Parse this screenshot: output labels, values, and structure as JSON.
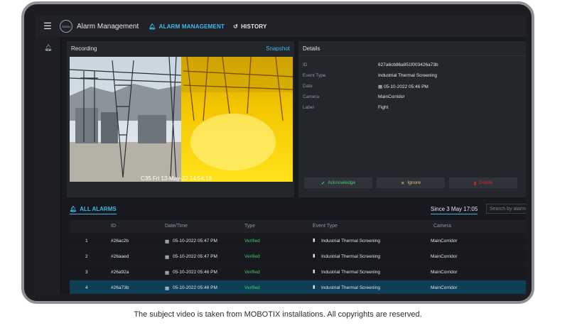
{
  "header": {
    "logo_text": "SOGU",
    "app_title": "Alarm Management",
    "nav_alarm": "ALARM MANAGEMENT",
    "nav_history": "HISTORY"
  },
  "recording": {
    "title": "Recording",
    "snapshot_label": "Snapshot",
    "timestamp": "C35 Fri 13-May-22 14:54:18"
  },
  "details": {
    "title": "Details",
    "rows": [
      {
        "label": "ID",
        "value": "627a6cb86a951f003426a73b"
      },
      {
        "label": "Event Type",
        "value": "Industrial Thermal Screening"
      },
      {
        "label": "Date",
        "value": "05-10-2022 05:46 PM"
      },
      {
        "label": "Camera",
        "value": "MainCorridor"
      },
      {
        "label": "Label",
        "value": "Fight"
      }
    ],
    "buttons": {
      "acknowledge": "Acknowledge",
      "ignore": "Ignore",
      "delete": "Delete"
    }
  },
  "alarms": {
    "title": "ALL ALARMS",
    "since": "Since 3 May 17:05",
    "search_placeholder": "Search by alarm",
    "columns": [
      "ID",
      "Date/Time",
      "Type",
      "Event Type",
      "Camera"
    ],
    "rows": [
      {
        "n": "1",
        "id": "#26ac2b",
        "date": "05-10-2022 05:47 PM",
        "type": "Verified",
        "event": "Industrial Thermal Screening",
        "camera": "MainCorridor"
      },
      {
        "n": "2",
        "id": "#26aaed",
        "date": "05-10-2022 05:47 PM",
        "type": "Verified",
        "event": "Industrial Thermal Screening",
        "camera": "MainCorridor"
      },
      {
        "n": "3",
        "id": "#26a92a",
        "date": "05-10-2022 05:46 PM",
        "type": "Verified",
        "event": "Industrial Thermal Screening",
        "camera": "MainCorridor"
      },
      {
        "n": "4",
        "id": "#26a73b",
        "date": "05-10-2022 05:46 PM",
        "type": "Verified",
        "event": "Industrial Thermal Screening",
        "camera": "MainCorridor"
      }
    ]
  },
  "caption": "The subject video is taken from MOBOTIX installations. All copyrights are reserved.",
  "colors": {
    "accent": "#3fb8e8",
    "verified": "#3fcf6a",
    "selected_row": "#0e3f56",
    "delete": "#e02020"
  }
}
